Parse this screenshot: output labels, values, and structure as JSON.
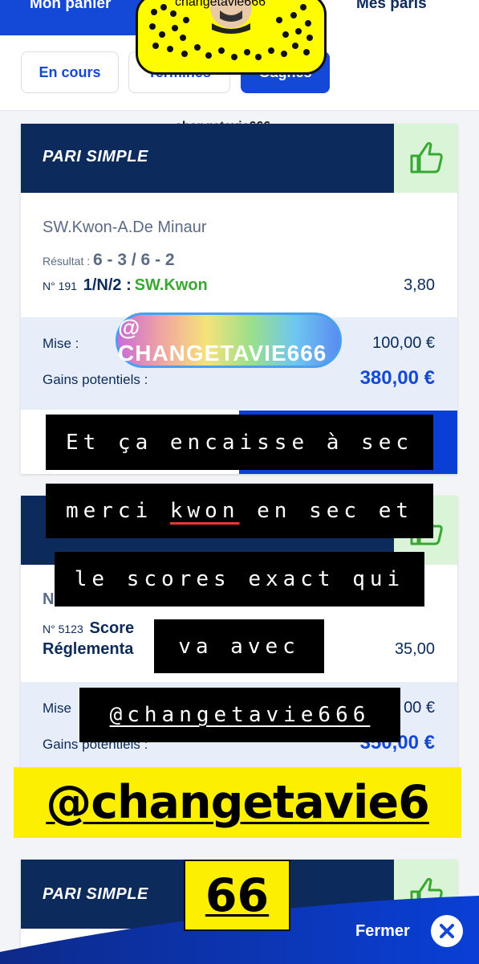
{
  "header": {
    "tab_left": "Mon panier",
    "tab_right": "Mes paris"
  },
  "filters": [
    {
      "label": "En cours",
      "active": false
    },
    {
      "label": "Terminés",
      "active": false
    },
    {
      "label": "Gagnés",
      "active": true
    }
  ],
  "snapcode": {
    "username": "changetavie666"
  },
  "ticket1": {
    "title": "PARI SIMPLE",
    "match": "SW.Kwon-A.De Minaur",
    "result_label": "Résultat :",
    "result_value": "6 - 3 / 6 - 2",
    "bet_number": "N° 191",
    "bet_type": "1/N/2 :",
    "selection": "SW.Kwon",
    "odds": "3,80",
    "stake_label": "Mise :",
    "stake_value": "100,00 €",
    "gains_label": "Gains potentiels :",
    "gains_value": "380,00 €"
  },
  "ticket2": {
    "match_prefix": "N",
    "bet_number": "N° 5123",
    "bet_line1": "Score",
    "bet_line2": "Réglementa",
    "odds": "35,00",
    "stake_label": "Mise",
    "stake_value_partial": "00 €",
    "gains_label": "Gains potentiels :",
    "gains_value_partial": "350,00 €"
  },
  "ticket3": {
    "title": "PARI SIMPLE"
  },
  "overlays": {
    "rainbow_tag": "@ CHANGETAVIE666",
    "caption1": "Et ça encaisse à sec",
    "caption2_a": "merci ",
    "caption2_b": "kwon",
    "caption2_c": " en sec et",
    "caption3": "le scores exact qui",
    "caption4": "va avec",
    "caption5": "@changetavie666",
    "yellow_handle": "@changetavie6",
    "yellow_66": "66"
  },
  "footer": {
    "close_label": "Fermer"
  },
  "colors": {
    "brand_blue": "#1448d6",
    "navy": "#0d2a5c",
    "win_green": "#38a832",
    "snap_yellow": "#fffc00"
  }
}
